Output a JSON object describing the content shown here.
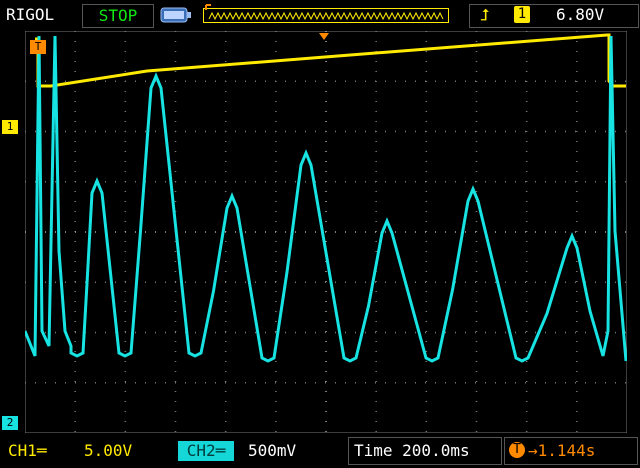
{
  "brand": "RIGOL",
  "run_state": "STOP",
  "trigger": {
    "edge_icon": "rising-edge",
    "source": "1",
    "level": "6.80V"
  },
  "markers": {
    "trig_pos": "T",
    "ch1": "1",
    "ch2": "2"
  },
  "bottom": {
    "ch1_label": "CH1═",
    "ch1_scale": "5.00V",
    "ch2_label": "CH2═",
    "ch2_scale": "500mV",
    "timebase": "Time 200.0ms",
    "offset": "→1.144s"
  },
  "colors": {
    "ch1": "#ffea00",
    "ch2": "#17e3e3",
    "status_green": "#11e711",
    "trigger_orange": "#ff8a00",
    "grid": "#8a8a8a"
  }
}
